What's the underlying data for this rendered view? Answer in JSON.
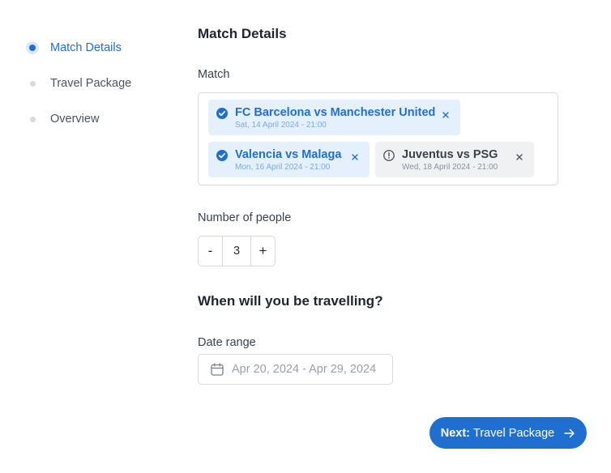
{
  "steps": [
    {
      "label": "Match Details",
      "state": "active"
    },
    {
      "label": "Travel Package",
      "state": "pending"
    },
    {
      "label": "Overview",
      "state": "pending"
    }
  ],
  "form": {
    "title": "Match Details",
    "match_label": "Match",
    "matches": [
      {
        "title": "FC Barcelona vs Manchester United",
        "date": "Sat, 14 April 2024 - 21:00",
        "selected": true
      },
      {
        "title": "Valencia vs Malaga",
        "date": "Mon, 16 April 2024 - 21:00",
        "selected": true
      },
      {
        "title": "Juventus vs PSG",
        "date": "Wed, 18 April 2024 - 21:00",
        "selected": false
      }
    ],
    "people_label": "Number of people",
    "people": {
      "decrement": "-",
      "value": "3",
      "increment": "+"
    },
    "travel_heading": "When will you be travelling?",
    "date_range_label": "Date range",
    "date_range_placeholder": "Apr 20, 2024 - Apr 29, 2024"
  },
  "next_button": {
    "prefix": "Next:",
    "label": "Travel Package"
  },
  "colors": {
    "accent": "#1f6fd1",
    "accent_light": "#e5f0fd",
    "neutral_chip": "#f0f1f3",
    "border": "#d6dae0"
  },
  "icons": {
    "selected": "check-circle-icon",
    "unselected": "info-circle-icon",
    "remove": "close-icon",
    "date": "calendar-icon",
    "next": "arrow-right-icon"
  }
}
